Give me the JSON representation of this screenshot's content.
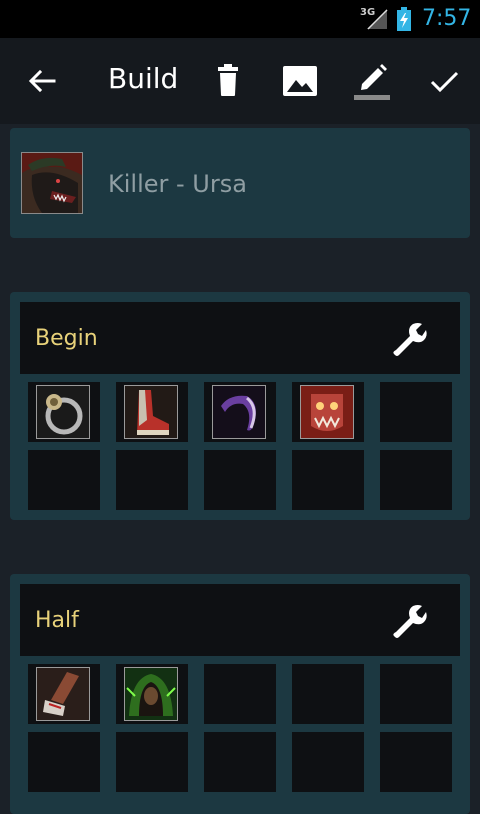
{
  "status_bar": {
    "network": "3G",
    "time": "7:57",
    "colors": {
      "time": "#33b5e5",
      "battery": "#33b5e5"
    }
  },
  "action_bar": {
    "title": "Build",
    "icons": [
      "back-arrow-icon",
      "delete-icon",
      "image-icon",
      "edit-icon",
      "done-icon"
    ]
  },
  "hero": {
    "name": "Killer - Ursa",
    "portrait_icon": "ursa-portrait"
  },
  "sections": [
    {
      "title": "Begin",
      "slots": [
        "ring-item",
        "boots-item",
        "claw-item",
        "mask-item",
        "empty",
        "empty",
        "empty",
        "empty",
        "empty",
        "empty"
      ]
    },
    {
      "title": "Half",
      "slots": [
        "greaves-item",
        "hooded-figure-item",
        "empty",
        "empty",
        "empty",
        "empty",
        "empty",
        "empty",
        "empty",
        "empty"
      ]
    }
  ],
  "colors": {
    "background": "#1b2128",
    "card": "#1c3841",
    "slot": "#0e1013",
    "section_title": "#e8d27a",
    "hero_name": "#8f9ea3"
  }
}
